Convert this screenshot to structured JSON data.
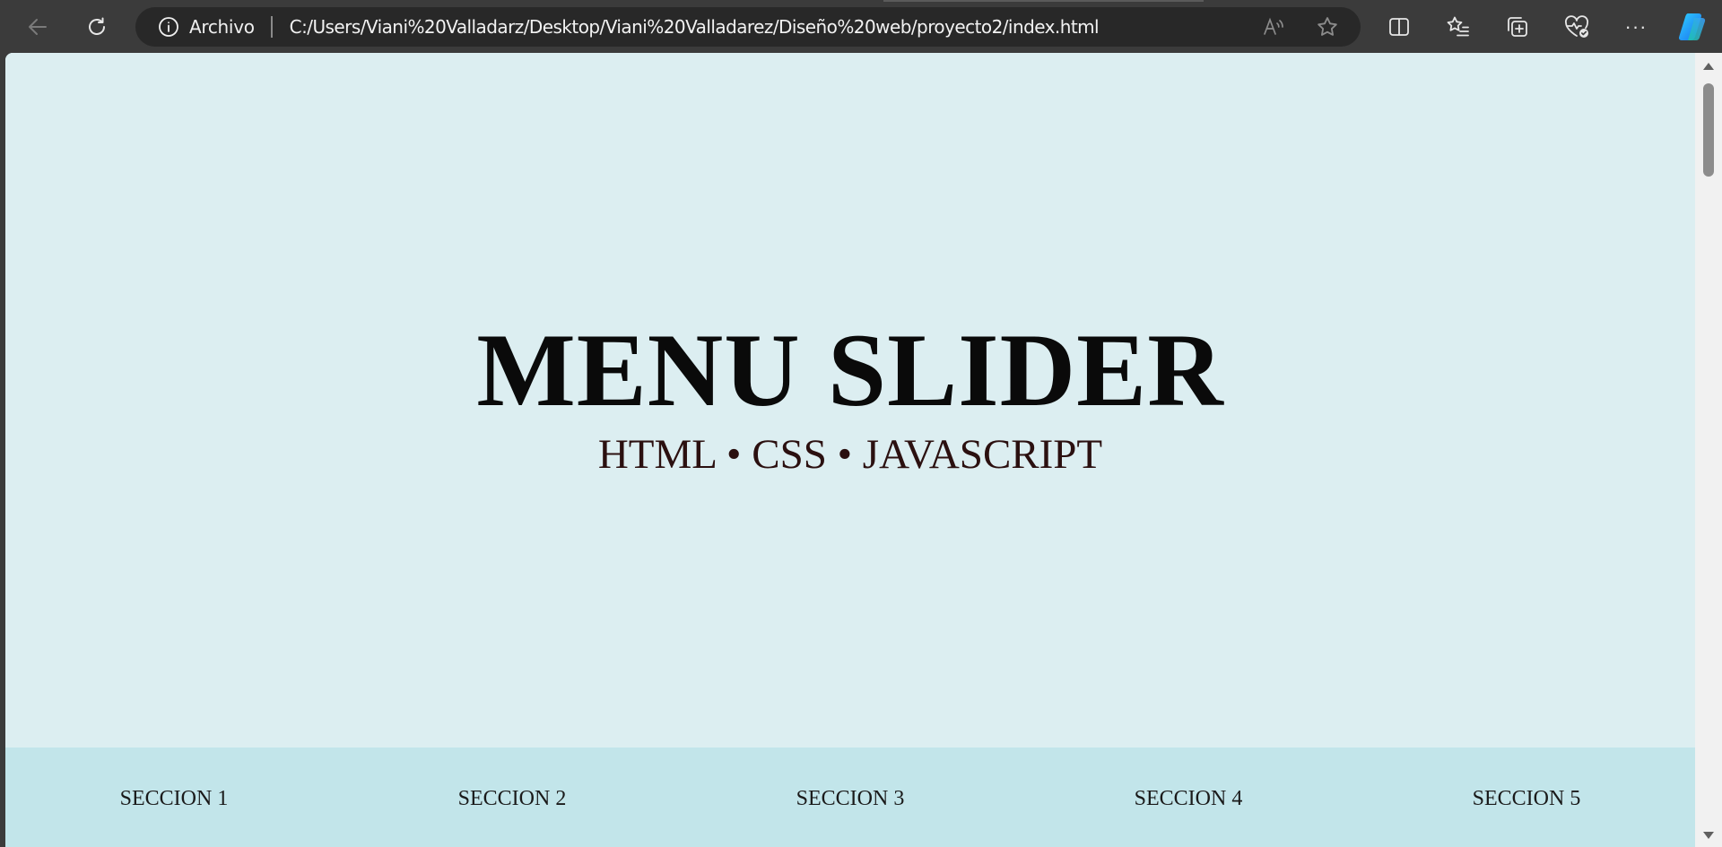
{
  "browser": {
    "site_info_label": "Archivo",
    "url": "C:/Users/Viani%20Valladarz/Desktop/Viani%20Valladarez/Diseño%20web/proyecto2/index.html",
    "read_aloud_glyph": "A))",
    "more_glyph": "···",
    "icons": [
      "back-arrow-icon",
      "reload-icon",
      "info-icon",
      "read-aloud-icon",
      "star-icon",
      "split-screen-icon",
      "favorites-icon",
      "collections-icon",
      "browser-essentials-icon",
      "more-icon",
      "copilot-icon"
    ]
  },
  "page": {
    "hero": {
      "title": "MENU SLIDER",
      "subtitle": "HTML • CSS • JAVASCRIPT"
    },
    "sections": [
      {
        "label": "SECCION 1"
      },
      {
        "label": "SECCION 2"
      },
      {
        "label": "SECCION 3"
      },
      {
        "label": "SECCION 4"
      },
      {
        "label": "SECCION 5"
      }
    ]
  },
  "colors": {
    "chrome_bg": "#3b3b3b",
    "address_bg": "#282828",
    "hero_bg": "#dceef1",
    "section_bar_bg": "#c2e5ea",
    "title_color": "#0a0a0a",
    "subtitle_color": "#2b1010"
  }
}
